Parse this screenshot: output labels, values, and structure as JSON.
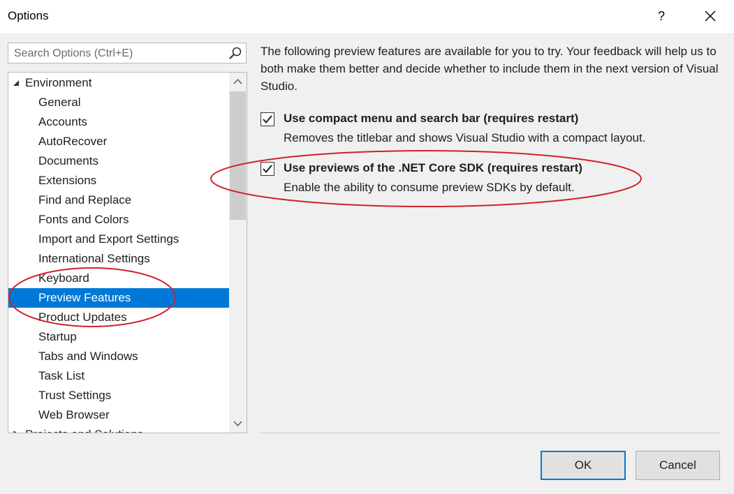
{
  "window": {
    "title": "Options",
    "help_label": "?",
    "close_icon": "close-icon"
  },
  "search": {
    "placeholder": "Search Options (Ctrl+E)",
    "icon": "search-icon"
  },
  "tree": {
    "parent_label": "Environment",
    "expander_icon": "triangle-down-icon",
    "items": [
      {
        "label": "General"
      },
      {
        "label": "Accounts"
      },
      {
        "label": "AutoRecover"
      },
      {
        "label": "Documents"
      },
      {
        "label": "Extensions"
      },
      {
        "label": "Find and Replace"
      },
      {
        "label": "Fonts and Colors"
      },
      {
        "label": "Import and Export Settings"
      },
      {
        "label": "International Settings"
      },
      {
        "label": "Keyboard"
      },
      {
        "label": "Preview Features"
      },
      {
        "label": "Product Updates"
      },
      {
        "label": "Startup"
      },
      {
        "label": "Tabs and Windows"
      },
      {
        "label": "Task List"
      },
      {
        "label": "Trust Settings"
      },
      {
        "label": "Web Browser"
      }
    ],
    "selected": "Preview Features",
    "next_parent_label": "Projects and Solutions"
  },
  "content": {
    "description": "The following preview features are available for you to try. Your feedback will help us to both make them better and decide whether to include them in the next version of Visual Studio.",
    "features": [
      {
        "label": "Use compact menu and search bar (requires restart)",
        "description": "Removes the titlebar and shows Visual Studio with a compact layout.",
        "checked": true
      },
      {
        "label": "Use previews of the .NET Core SDK (requires restart)",
        "description": "Enable the ability to consume preview SDKs by default.",
        "checked": true
      }
    ]
  },
  "buttons": {
    "ok": "OK",
    "cancel": "Cancel"
  },
  "colors": {
    "selection": "#0078d7",
    "annotation": "#d0202a",
    "background": "#f0f0f0"
  }
}
